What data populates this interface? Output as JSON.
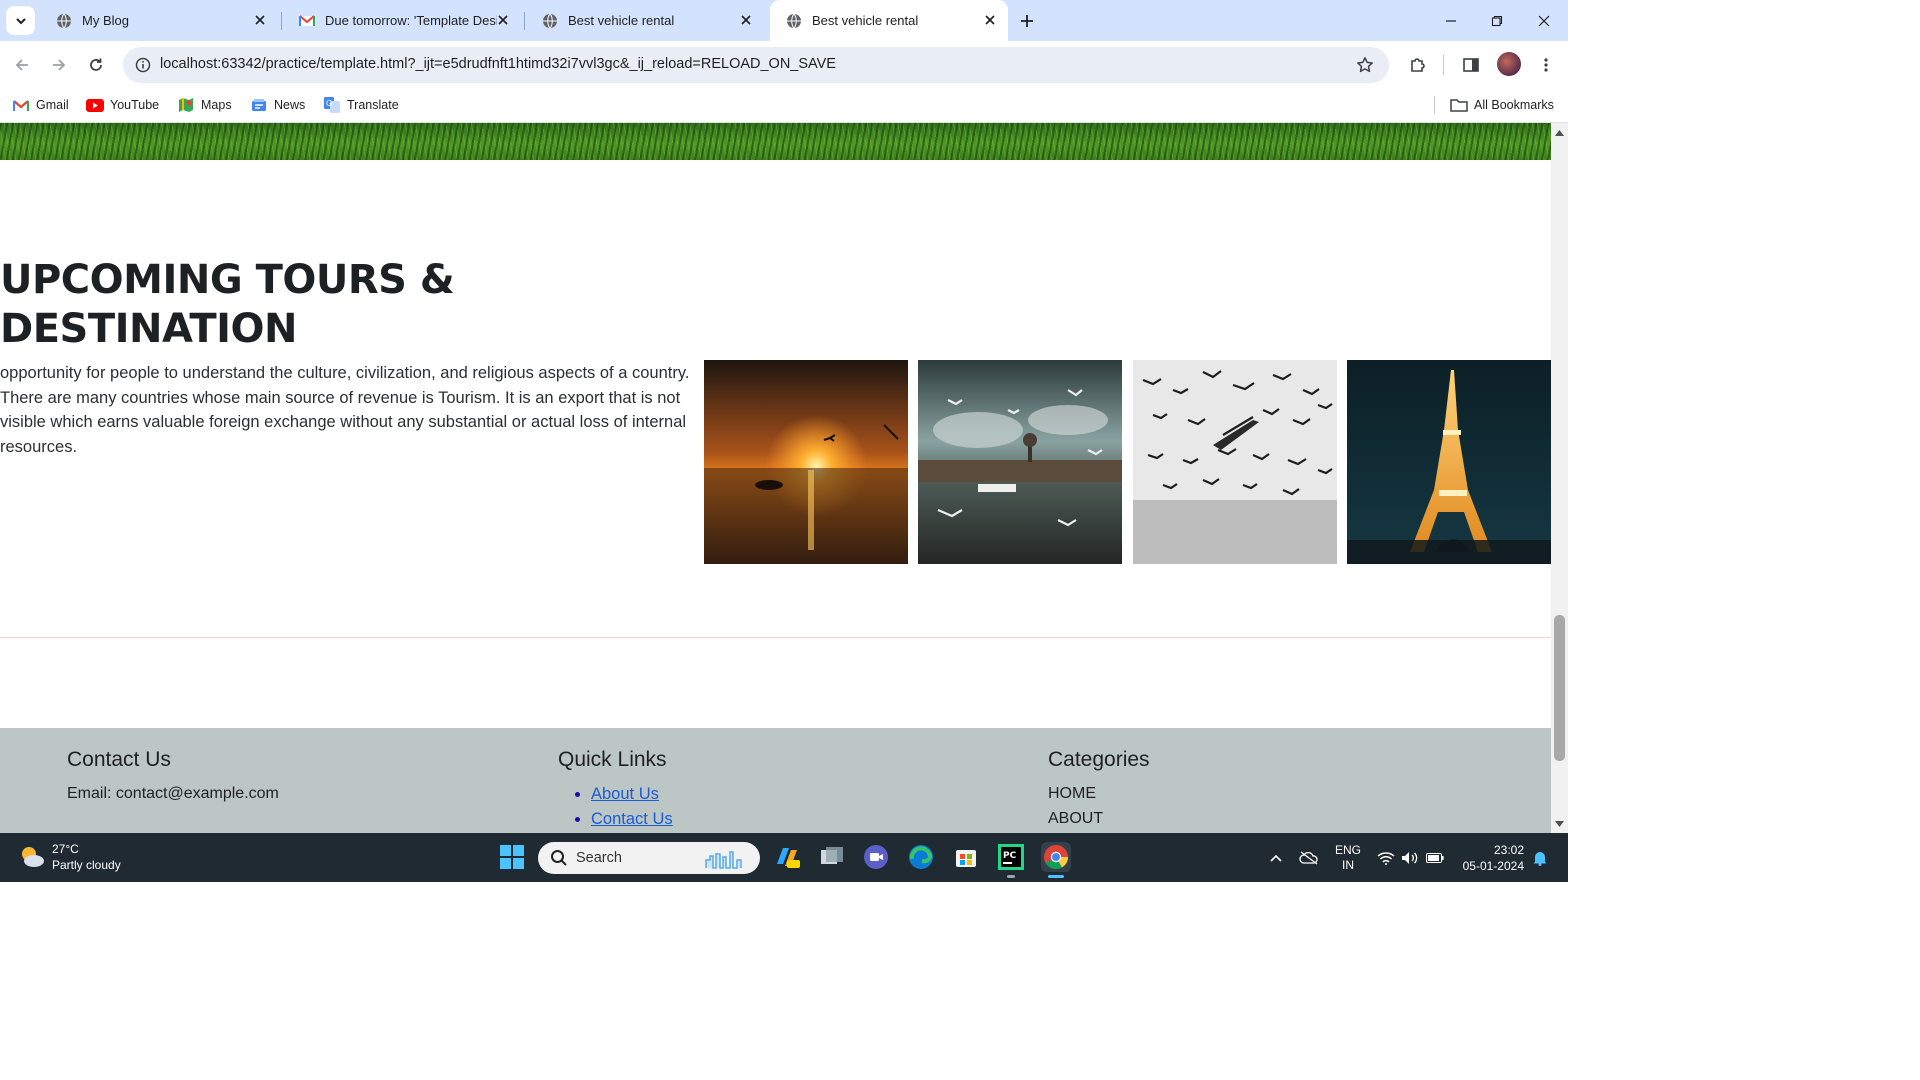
{
  "browser": {
    "tabs": [
      {
        "title": "My Blog",
        "icon": "globe-icon",
        "active": false
      },
      {
        "title": "Due tomorrow: 'Template Desig",
        "icon": "gmail-icon",
        "active": false
      },
      {
        "title": "Best vehicle rental",
        "icon": "globe-icon",
        "active": false
      },
      {
        "title": "Best vehicle rental",
        "icon": "globe-icon",
        "active": true
      }
    ],
    "url": "localhost:63342/practice/template.html?_ijt=e5drudfnft1htimd32i7vvl3gc&_ij_reload=RELOAD_ON_SAVE",
    "bookmarks": [
      {
        "label": "Gmail",
        "icon": "gmail-icon"
      },
      {
        "label": "YouTube",
        "icon": "youtube-icon"
      },
      {
        "label": "Maps",
        "icon": "maps-icon"
      },
      {
        "label": "News",
        "icon": "news-icon"
      },
      {
        "label": "Translate",
        "icon": "translate-icon"
      }
    ],
    "all_bookmarks": "All Bookmarks"
  },
  "page": {
    "tours": {
      "title_line1": "UPCOMING TOURS &",
      "title_line2": "DESTINATION",
      "text": "opportunity for people to understand the culture, civilization, and religious aspects of a country. There are many countries whose main source of revenue is Tourism. It is an export that is not visible which earns valuable foreign exchange without any substantial or actual loss of internal resources.",
      "photos": [
        "sunset-seagull-photo",
        "harbor-seagulls-photo",
        "flock-of-birds-photo",
        "eiffel-tower-photo"
      ]
    },
    "footer": {
      "contact": {
        "heading": "Contact Us",
        "email": "Email: contact@example.com"
      },
      "quick_links": {
        "heading": "Quick Links",
        "links": [
          "About Us",
          "Contact Us"
        ]
      },
      "categories": {
        "heading": "Categories",
        "items": [
          "HOME",
          "ABOUT"
        ]
      }
    }
  },
  "taskbar": {
    "weather_temp": "27°C",
    "weather_desc": "Partly cloudy",
    "search_placeholder": "Search",
    "lang_top": "ENG",
    "lang_bottom": "IN",
    "time": "23:02",
    "date": "05-01-2024"
  }
}
